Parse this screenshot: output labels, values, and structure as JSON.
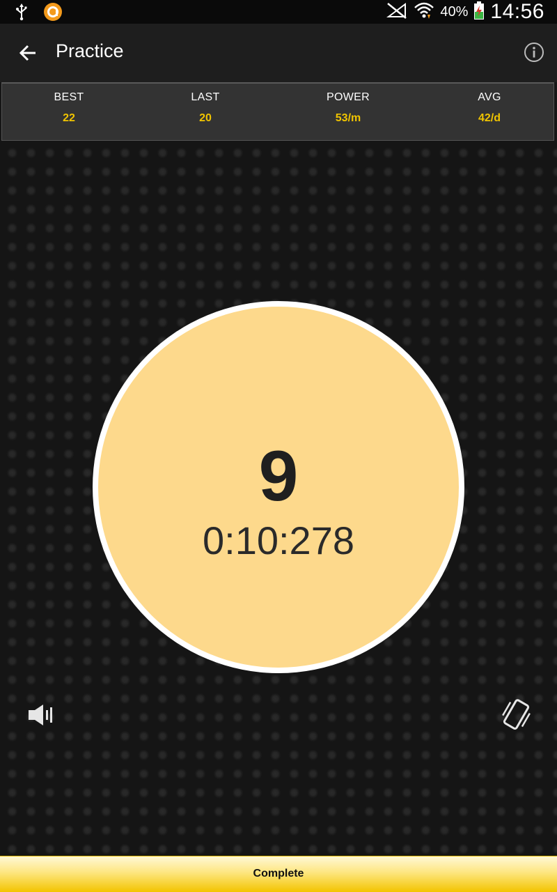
{
  "status_bar": {
    "battery_percent": "40%",
    "time": "14:56",
    "icons": [
      "usb-icon",
      "app-notification-icon",
      "no-signal-icon",
      "wifi-icon",
      "battery-charging-icon"
    ]
  },
  "app_bar": {
    "title": "Practice",
    "back_icon": "arrow-back-icon",
    "info_icon": "info-icon"
  },
  "stats": [
    {
      "label": "BEST",
      "value": "22"
    },
    {
      "label": "LAST",
      "value": "20"
    },
    {
      "label": "POWER",
      "value": "53/m"
    },
    {
      "label": "AVG",
      "value": "42/d"
    }
  ],
  "counter": {
    "count": "9",
    "elapsed": "0:10:278"
  },
  "controls": {
    "sound_icon": "volume-icon",
    "vibrate_icon": "vibrate-icon"
  },
  "footer": {
    "complete_label": "Complete"
  },
  "colors": {
    "accent_yellow": "#f0c400",
    "circle_fill": "#fdd98c",
    "background": "#151515"
  }
}
